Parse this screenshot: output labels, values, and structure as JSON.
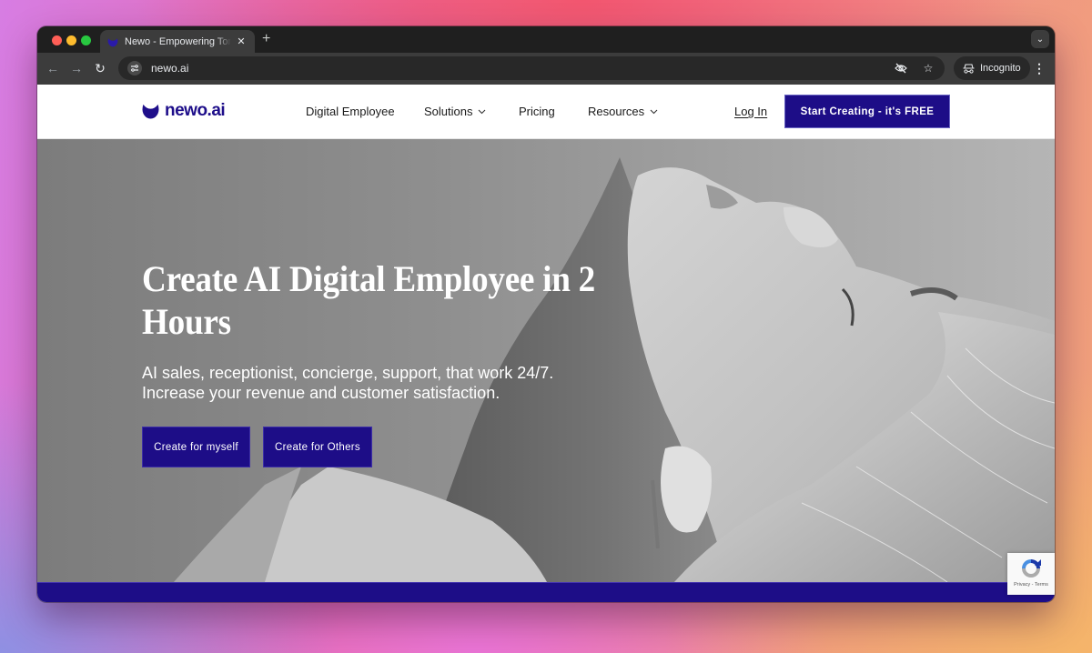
{
  "browser": {
    "tab": {
      "title": "Newo - Empowering Tomorrow's Workforce",
      "favicon": "newo-logo-icon",
      "close_icon": "close-icon"
    },
    "new_tab_icon": "plus-icon",
    "tab_search_icon": "chevron-down-icon",
    "nav": {
      "back_icon": "arrow-left-icon",
      "forward_icon": "arrow-right-icon",
      "reload_icon": "reload-icon"
    },
    "url": "newo.ai",
    "omnibox_icons": [
      "eye-slash-icon",
      "star-icon"
    ],
    "incognito_label": "Incognito",
    "menu_icon": "more-vertical-icon"
  },
  "site": {
    "brand": {
      "name": "newo.ai",
      "color": "#1e0e8a"
    },
    "nav": [
      {
        "label": "Digital Employee",
        "has_dropdown": false
      },
      {
        "label": "Solutions",
        "has_dropdown": true
      },
      {
        "label": "Pricing",
        "has_dropdown": false
      },
      {
        "label": "Resources",
        "has_dropdown": true
      }
    ],
    "login_label": "Log In",
    "cta_label": "Start Creating - it's FREE"
  },
  "hero": {
    "title": "Create AI Digital Employee in 2 Hours",
    "subtitle_line1": "AI sales, receptionist, concierge, support, that work 24/7.",
    "subtitle_line2": "Increase your revenue and customer satisfaction.",
    "buttons": [
      {
        "label": "Create for myself"
      },
      {
        "label": "Create for Others"
      }
    ],
    "image": "black-and-white portrait of person lying back with eyes closed"
  },
  "recaptcha": {
    "label": "Privacy - Terms"
  },
  "colors": {
    "primary": "#1d0d87",
    "header_bg": "#ffffff",
    "chrome_dark": "#1f1f1f",
    "chrome_toolbar": "#3c3c3c"
  }
}
